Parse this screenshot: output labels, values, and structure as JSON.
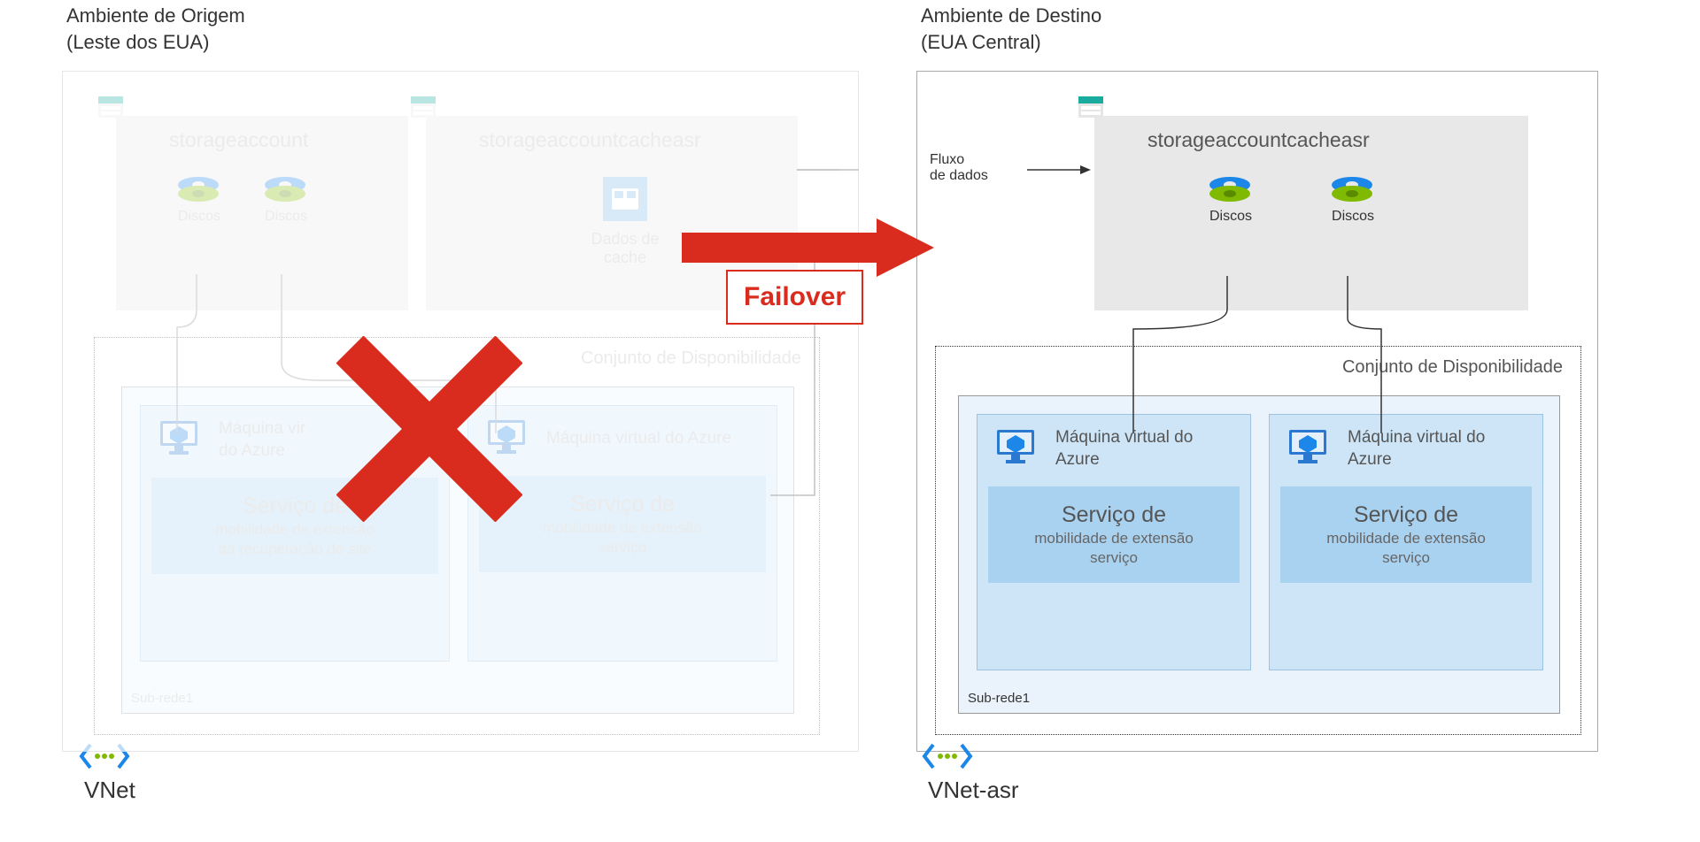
{
  "source": {
    "title": "Ambiente de Origem",
    "subtitle": "(Leste dos EUA)",
    "storage_account": "storageaccount",
    "storage_cache": "storageaccountcacheasr",
    "disks_label": "Discos",
    "cache_label": "Dados de cache",
    "avset_title": "Conjunto de Disponibilidade",
    "subnet": "Sub-rede1",
    "vm_label": "Máquina virtual do Azure",
    "vm_label_line1": "Máquina vir",
    "vm_label_line2": "do Azure",
    "svc_title": "Serviço de",
    "svc_sub1": "mobilidade de extensão",
    "svc_sub2_a": "da recuperação de site",
    "svc_sub2_b": "serviço",
    "vnet": "VNet"
  },
  "target": {
    "title": "Ambiente de Destino",
    "subtitle": "(EUA Central)",
    "storage_cache": "storageaccountcacheasr",
    "disks_label": "Discos",
    "avset_title": "Conjunto de Disponibilidade",
    "subnet": "Sub-rede1",
    "vm_label": "Máquina virtual do Azure",
    "svc_title": "Serviço de",
    "svc_sub1": "mobilidade de extensão",
    "svc_sub2": "serviço",
    "vnet": "VNet-asr"
  },
  "flow": {
    "label_line1": "Fluxo",
    "label_line2": "de dados"
  },
  "failover": "Failover"
}
